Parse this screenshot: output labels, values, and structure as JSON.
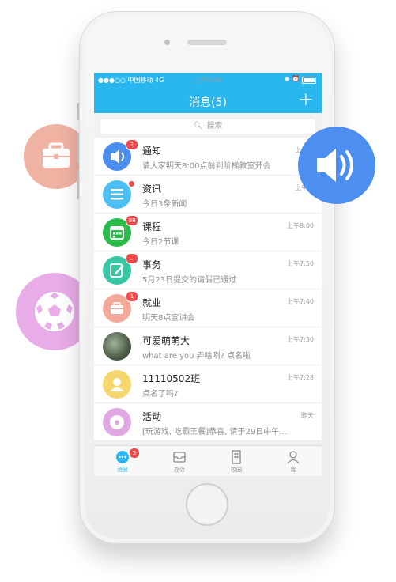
{
  "status_bar": {
    "carrier": "●●●○○ 中国移动  4G",
    "time": "上午9:46",
    "icons": "◉ ⏰"
  },
  "nav": {
    "title": "消息(5)",
    "add_icon": "plus-icon"
  },
  "search": {
    "placeholder": "搜索"
  },
  "messages": [
    {
      "name": "通知",
      "preview": "请大家明天8:00点前到阶梯教室开会",
      "time": "上午9:",
      "badge": "2",
      "icon": "speaker-icon",
      "color": "#4a8ff0"
    },
    {
      "name": "资讯",
      "preview": "今日3条新闻",
      "time": "上午8:",
      "badge": "",
      "icon": "news-list-icon",
      "color": "#4cc0f5"
    },
    {
      "name": "课程",
      "preview": "今日2节课",
      "time": "上午8:00",
      "badge": "98",
      "icon": "calendar-icon",
      "color": "#2dbb4c"
    },
    {
      "name": "事务",
      "preview": "5月23日提交的请假已通过",
      "time": "上午7:50",
      "badge": "…",
      "icon": "edit-icon",
      "color": "#37c7a4"
    },
    {
      "name": "就业",
      "preview": "明天8点宣讲会",
      "time": "上午7:40",
      "badge": "1",
      "icon": "briefcase-icon",
      "color": "#f2a99a"
    },
    {
      "name": "可爱萌萌大",
      "preview": "what are you 弄啥咧? 点名啦",
      "time": "上午7:30",
      "badge": "",
      "icon": "photo-avatar",
      "color": "#6b7a5c"
    },
    {
      "name": "11110502班",
      "preview": "点名了吗?",
      "time": "上午7:28",
      "badge": "",
      "icon": "group-icon",
      "color": "#f5d76e"
    },
    {
      "name": "活动",
      "preview": "[玩游戏, 吃霸王餐]恭喜, 请于29日中午...",
      "time": "昨天",
      "badge": "",
      "icon": "soccer-ball-icon",
      "color": "#e0a8e3"
    }
  ],
  "tabs": [
    {
      "label": "消息",
      "icon": "chat-icon",
      "badge": "5",
      "active": true
    },
    {
      "label": "办公",
      "icon": "inbox-icon",
      "active": false
    },
    {
      "label": "校园",
      "icon": "building-icon",
      "active": false
    },
    {
      "label": "我",
      "icon": "person-icon",
      "active": false
    }
  ],
  "bubbles": {
    "briefcase_color": "#f0b2a3",
    "speaker_color": "#4d8ff0",
    "soccer_color": "#e8ace8"
  }
}
